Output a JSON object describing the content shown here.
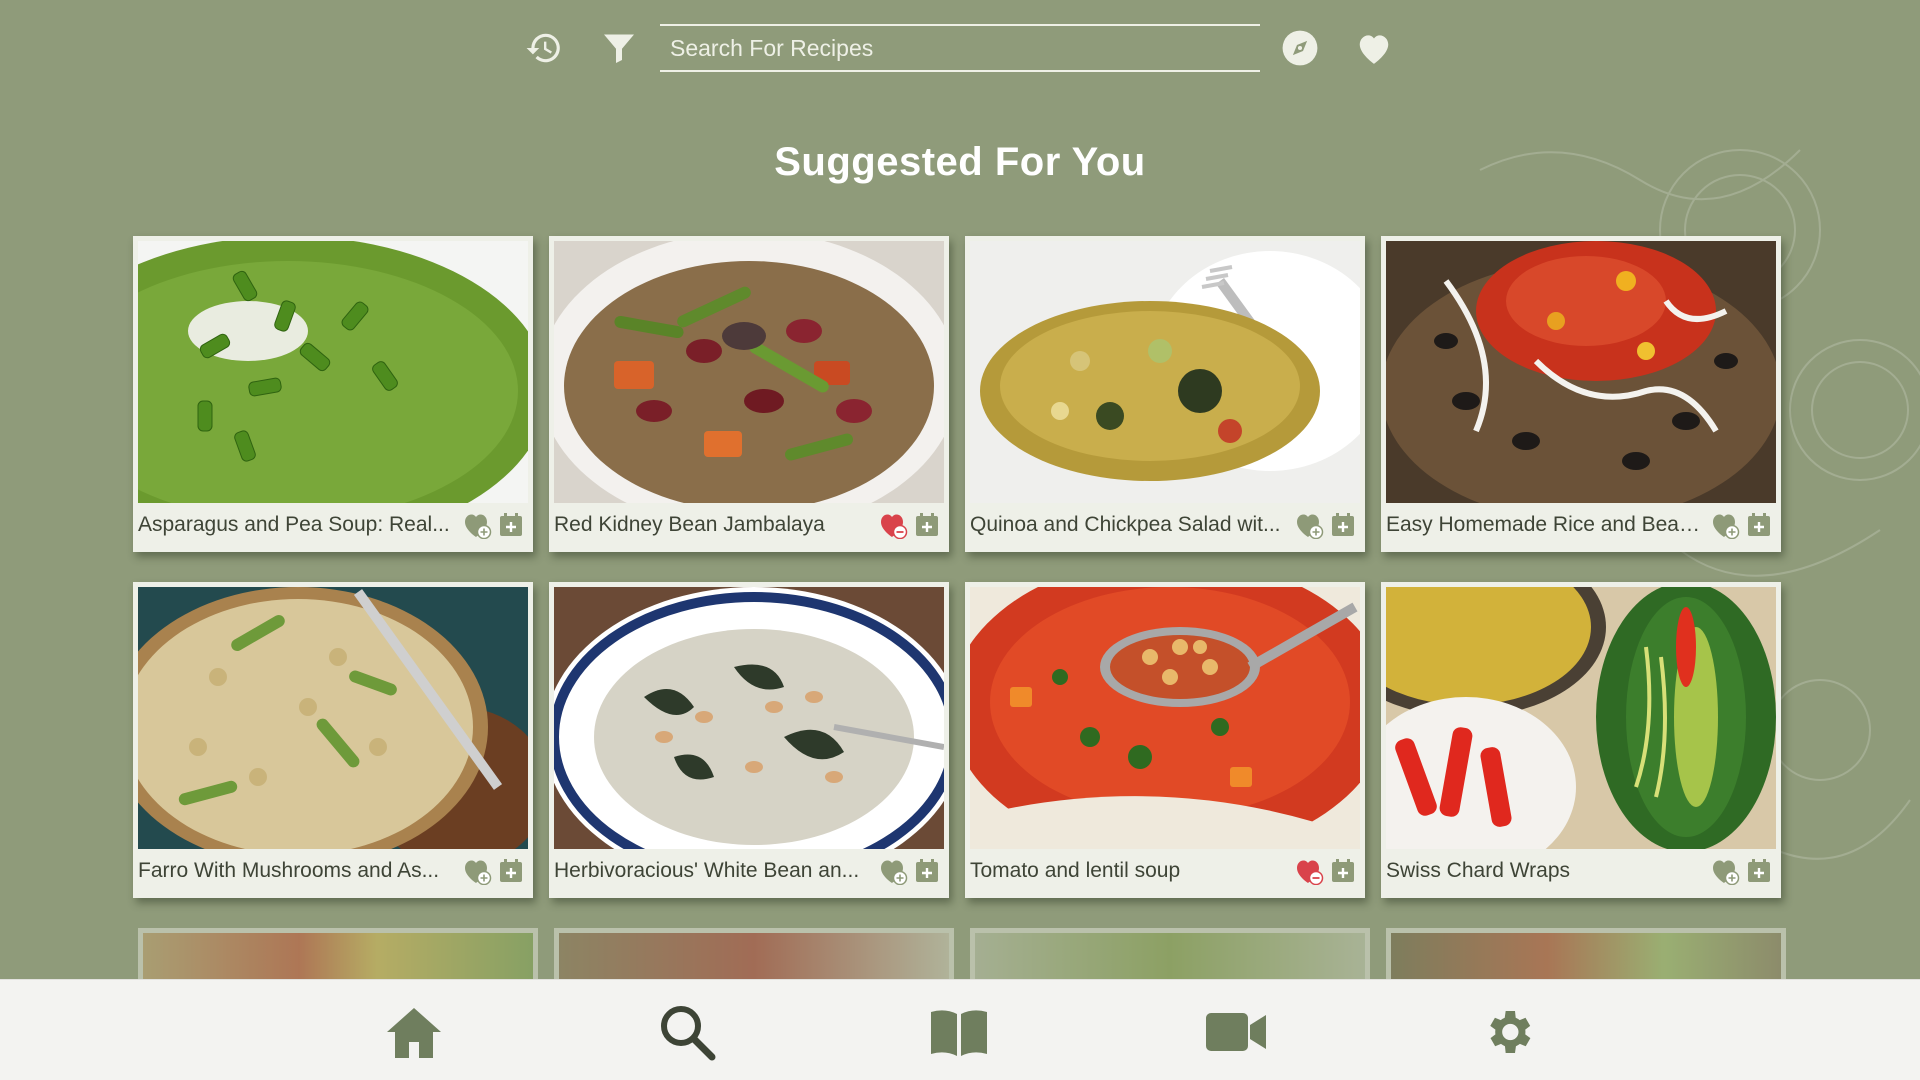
{
  "topbar": {
    "search_placeholder": "Search For Recipes",
    "icons": [
      "history-icon",
      "filter-icon",
      "compass-icon",
      "favorites-heart-icon"
    ]
  },
  "section": {
    "title": "Suggested For You"
  },
  "recipes": [
    {
      "title": "Asparagus and Pea Soup: Real...",
      "favorited": false
    },
    {
      "title": "Red Kidney Bean Jambalaya",
      "favorited": true
    },
    {
      "title": "Quinoa and Chickpea Salad wit...",
      "favorited": false
    },
    {
      "title": "Easy Homemade Rice and Beans",
      "favorited": false
    },
    {
      "title": "Farro With Mushrooms and As...",
      "favorited": false
    },
    {
      "title": "Herbivoracious' White Bean an...",
      "favorited": false
    },
    {
      "title": "Tomato and lentil soup",
      "favorited": true
    },
    {
      "title": "Swiss Chard Wraps",
      "favorited": false
    }
  ],
  "bottom_nav": [
    "home-icon",
    "search-icon",
    "book-icon",
    "video-icon",
    "settings-gear-icon"
  ],
  "colors": {
    "background": "#8f9b7a",
    "card": "#eef0e8",
    "favorite": "#d9434b",
    "icon_muted": "#8e9a78",
    "nav_icon": "#6f7e5e"
  }
}
